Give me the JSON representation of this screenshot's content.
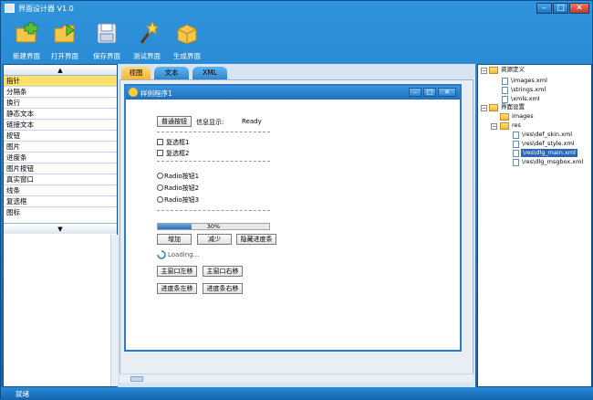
{
  "window": {
    "title": "界面设计器 V1.0"
  },
  "toolbar": {
    "buttons": [
      {
        "label": "新建界面",
        "icon": "new-folder-icon"
      },
      {
        "label": "打开界面",
        "icon": "open-folder-icon"
      },
      {
        "label": "保存界面",
        "icon": "save-disk-icon"
      },
      {
        "label": "测试界面",
        "icon": "magic-wand-icon"
      },
      {
        "label": "生成界面",
        "icon": "package-box-icon"
      }
    ]
  },
  "palette": {
    "scroll_up": "▲",
    "scroll_down": "▼",
    "items": [
      "指针",
      "分隔条",
      "换行",
      "静态文本",
      "链接文本",
      "按钮",
      "图片",
      "进度条",
      "图片按钮",
      "真实窗口",
      "线条",
      "复选框",
      "图标"
    ],
    "selected_index": 0
  },
  "tabs": [
    {
      "label": "视图",
      "active": true
    },
    {
      "label": "文本",
      "active": false
    },
    {
      "label": "XML",
      "active": false
    }
  ],
  "dialog": {
    "title": "样例程序1",
    "controls": {
      "normal_button": "普通按钮",
      "info_label": "信息显示:",
      "info_value": "Ready",
      "checkbox1": "复选框1",
      "checkbox2": "复选框2",
      "radio1": "Radio按钮1",
      "radio2": "Radio按钮2",
      "radio3": "Radio按钮3",
      "progress_text": "30%",
      "progress_value": 0.3,
      "add_button": "增加",
      "reduce_button": "减少",
      "hide_progress_button": "隐藏进度条",
      "loading_text": "Loading...",
      "main_left_button": "主窗口左移",
      "main_right_button": "主窗口右移",
      "prog_left_button": "进度条左移",
      "prog_right_button": "进度条右移"
    }
  },
  "tree": {
    "resource_def": "资源定义",
    "images_xml": "\\images.xml",
    "strings_xml": "\\strings.xml",
    "xmls_xml": "\\xmls.xml",
    "ui_settings": "界面设置",
    "images_folder": "images",
    "res_folder": "res",
    "def_skin": "\\res\\def_skin.xml",
    "def_style": "\\res\\def_style.xml",
    "dlg_main": "\\res\\dlg_main.xml",
    "dlg_msgbox": "\\res\\dlg_msgbox.xml"
  },
  "status": {
    "text": "就绪"
  },
  "colors": {
    "frame": "#1b78c4",
    "selected_item": "#ffe06a",
    "active_tab": "#ffb43a"
  }
}
